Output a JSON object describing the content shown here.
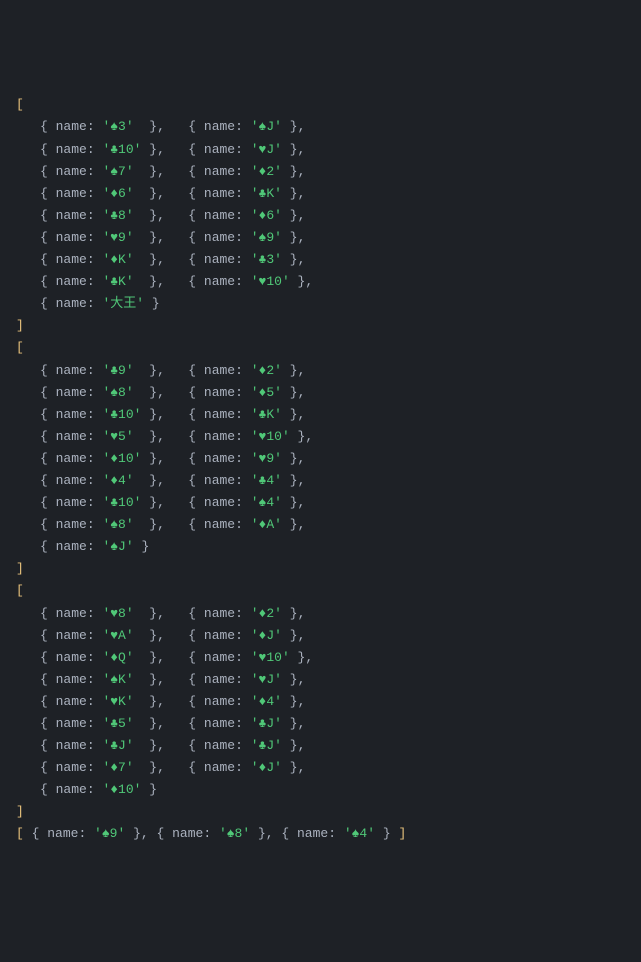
{
  "groups": [
    {
      "rows": [
        {
          "left": "♠3",
          "right": "♠J"
        },
        {
          "left": "♣10",
          "right": "♥J"
        },
        {
          "left": "♠7",
          "right": "♦2"
        },
        {
          "left": "♦6",
          "right": "♣K"
        },
        {
          "left": "♣8",
          "right": "♦6"
        },
        {
          "left": "♥9",
          "right": "♠9"
        },
        {
          "left": "♦K",
          "right": "♣3"
        },
        {
          "left": "♣K",
          "right": "♥10"
        },
        {
          "left": "大王"
        }
      ]
    },
    {
      "rows": [
        {
          "left": "♣9",
          "right": "♦2"
        },
        {
          "left": "♠8",
          "right": "♦5"
        },
        {
          "left": "♣10",
          "right": "♣K"
        },
        {
          "left": "♥5",
          "right": "♥10"
        },
        {
          "left": "♦10",
          "right": "♥9"
        },
        {
          "left": "♦4",
          "right": "♣4"
        },
        {
          "left": "♣10",
          "right": "♠4"
        },
        {
          "left": "♠8",
          "right": "♦A"
        },
        {
          "left": "♠J"
        }
      ]
    },
    {
      "rows": [
        {
          "left": "♥8",
          "right": "♦2"
        },
        {
          "left": "♥A",
          "right": "♦J"
        },
        {
          "left": "♦Q",
          "right": "♥10"
        },
        {
          "left": "♠K",
          "right": "♥J"
        },
        {
          "left": "♥K",
          "right": "♦4"
        },
        {
          "left": "♣5",
          "right": "♣J"
        },
        {
          "left": "♣J",
          "right": "♣J"
        },
        {
          "left": "♦7",
          "right": "♦J"
        },
        {
          "left": "♦10"
        }
      ]
    }
  ],
  "lastRow": [
    "♠9",
    "♠8",
    "♠4"
  ]
}
